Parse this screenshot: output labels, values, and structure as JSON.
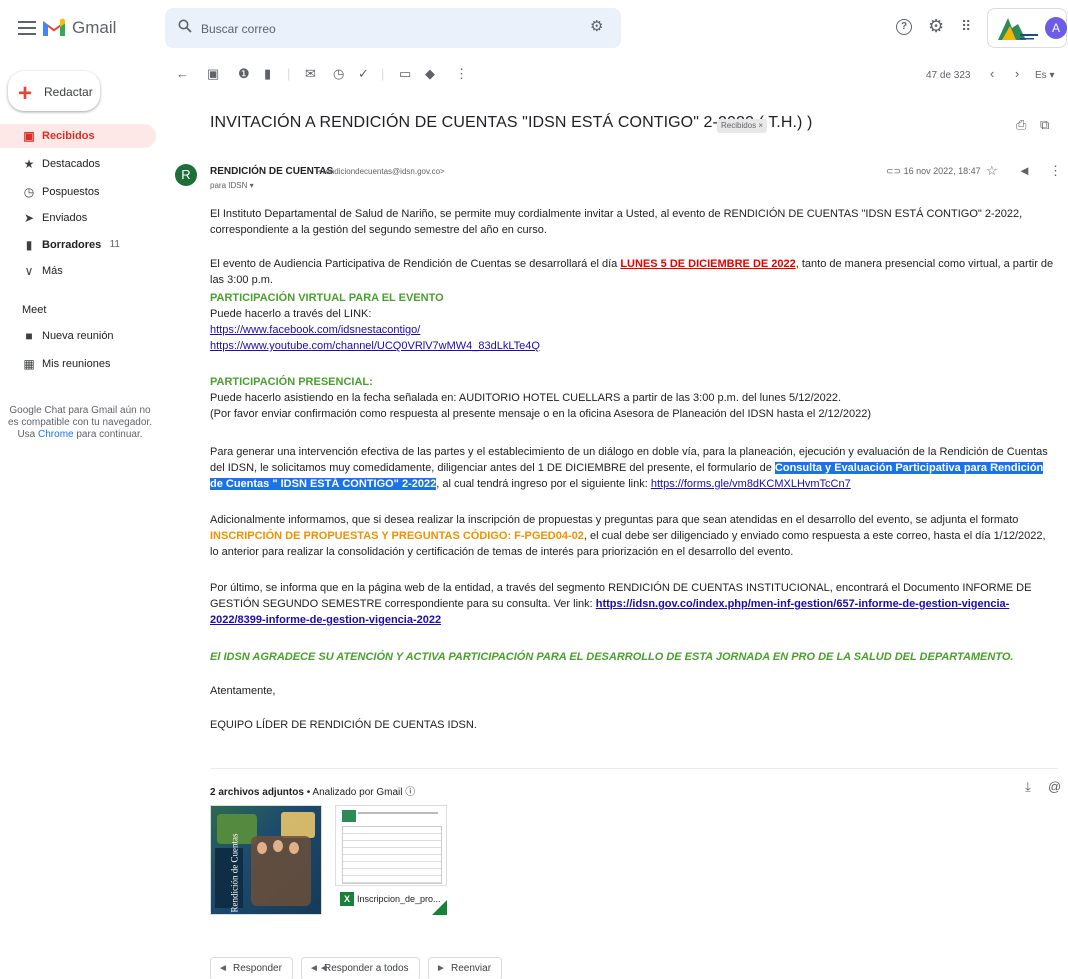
{
  "header": {
    "app_name": "Gmail",
    "search_placeholder": "Buscar correo",
    "avatar_initial": "A"
  },
  "sidebar": {
    "compose_label": "Redactar",
    "items": [
      {
        "label": "Recibidos",
        "icon": "inbox-icon",
        "count": ""
      },
      {
        "label": "Destacados",
        "icon": "star-icon",
        "count": ""
      },
      {
        "label": "Pospuestos",
        "icon": "clock-icon",
        "count": ""
      },
      {
        "label": "Enviados",
        "icon": "send-icon",
        "count": ""
      },
      {
        "label": "Borradores",
        "icon": "file-icon",
        "count": "11"
      },
      {
        "label": "Más",
        "icon": "chevron-down-icon",
        "count": ""
      }
    ],
    "meet_heading": "Meet",
    "meet_items": [
      {
        "label": "Nueva reunión",
        "icon": "video-icon"
      },
      {
        "label": "Mis reuniones",
        "icon": "calendar-icon"
      }
    ],
    "chat_note_before": "Google Chat para Gmail aún no es compatible con tu navegador. Usa ",
    "chat_note_link": "Chrome",
    "chat_note_after": " para continuar."
  },
  "toolbar": {
    "pager": "47 de 323",
    "lang": "Es"
  },
  "email": {
    "subject": "INVITACIÓN A RENDICIÓN DE CUENTAS \"IDSN ESTÁ CONTIGO\" 2-2022 ( T.H.) )",
    "label_chip": "Recibidos ×",
    "sender_initial": "R",
    "sender_name": "RENDICIÓN DE CUENTAS",
    "sender_email": "<rendiciondecuentas@idsn.gov.co>",
    "to_line": "para IDSN ▾",
    "date": "16 nov 2022, 18:47",
    "p1": "El Instituto Departamental de Salud de Nariño, se permite muy cordialmente invitar a Usted, al evento de RENDICIÓN DE CUENTAS  \"IDSN ESTÁ CONTIGO\" 2-2022, correspondiente a la gestión del segundo semestre del año en curso.",
    "p2_a": "El evento de Audiencia Participativa de Rendición de Cuentas se desarrollará el día ",
    "p2_b": "LUNES 5 DE DICIEMBRE DE 2022",
    "p2_c": ", tanto de manera presencial como virtual, a partir de las 3:00 p.m.",
    "virtual_h": "PARTICIPACIÓN VIRTUAL PARA EL EVENTO",
    "virtual_t": "Puede hacerlo a través del LINK:",
    "link_fb": "https://www.facebook.com/idsnestacontigo/",
    "link_yt": "https://www.youtube.com/channel/UCQ0VRlV7wMW4_83dLkLTe4Q",
    "pres_h": "PARTICIPACIÓN PRESENCIAL:",
    "pres_t1": "Puede hacerlo asistiendo en la fecha señalada en: AUDITORIO HOTEL CUELLARS a partir de las 3:00 p.m. del lunes 5/12/2022.",
    "pres_t2": "(Por favor enviar confirmación como respuesta al presente mensaje o en la oficina Asesora de Planeación del IDSN hasta el 2/12/2022)",
    "p3_a": "Para generar una intervención efectiva de las partes y el establecimiento de un diálogo en doble vía,  para la planeación, ejecución y evaluación de la Rendición de Cuentas del IDSN, le solicitamos muy comedidamente, diligenciar antes del 1 DE DICIEMBRE del presente, el formulario de ",
    "p3_b": "Consulta y Evaluación Participativa para Rendición de Cuentas \" IDSN ESTÁ CONTIGO\" 2-2022",
    "p3_c": ", al cual tendrá ingreso por el siguiente link: ",
    "p3_link": "https://forms.gle/vm8dKCMXLHvmTcCn7",
    "p4_a": "Adicionalmente  informamos, que si desea realizar la inscripción de propuestas y preguntas para que sean atendidas en el desarrollo del evento, se adjunta el formato  ",
    "p4_b": "INSCRIPCIÓN DE PROPUESTAS Y PREGUNTAS CÓDIGO: F-PGED04-02",
    "p4_c": ", el cual  debe ser diligenciado y enviado como respuesta a este correo, hasta el día 1/12/2022, lo anterior para realizar la consolidación y certificación de temas de interés para priorización en el desarrollo del evento.",
    "p5_a": "Por último, se informa que en la página web de la entidad, a través del segmento RENDICIÓN DE CUENTAS INSTITUCIONAL, encontrará el Documento INFORME DE GESTIÓN SEGUNDO SEMESTRE correspondiente para su consulta. Ver link:  ",
    "p5_link": "https://idsn.gov.co/index.php/men-inf-gestion/657-informe-de-gestion-vigencia-2022/8399-informe-de-gestion-vigencia-2022",
    "closing": "El IDSN  AGRADECE SU ATENCIÓN Y ACTIVA PARTICIPACIÓN PARA EL DESARROLLO DE ESTA JORNADA  EN PRO DE LA SALUD DEL DEPARTAMENTO.",
    "regards": "Atentamente,",
    "signature": "EQUIPO LÍDER DE RENDICIÓN DE CUENTAS IDSN."
  },
  "attachments": {
    "count_label": "2 archivos adjuntos",
    "scan_label": " • Analizado por Gmail ⓘ",
    "file1_text": "Rendición de Cuentas",
    "file2_name": "Inscripcion_de_pro..."
  },
  "actions": {
    "reply": "Responder",
    "reply_all": "Responder a todos",
    "forward": "Reenviar"
  },
  "colors": {
    "accent_red": "#d93025",
    "green": "#4aa02c",
    "orange": "#f29100",
    "highlight": "#1a73e8"
  }
}
